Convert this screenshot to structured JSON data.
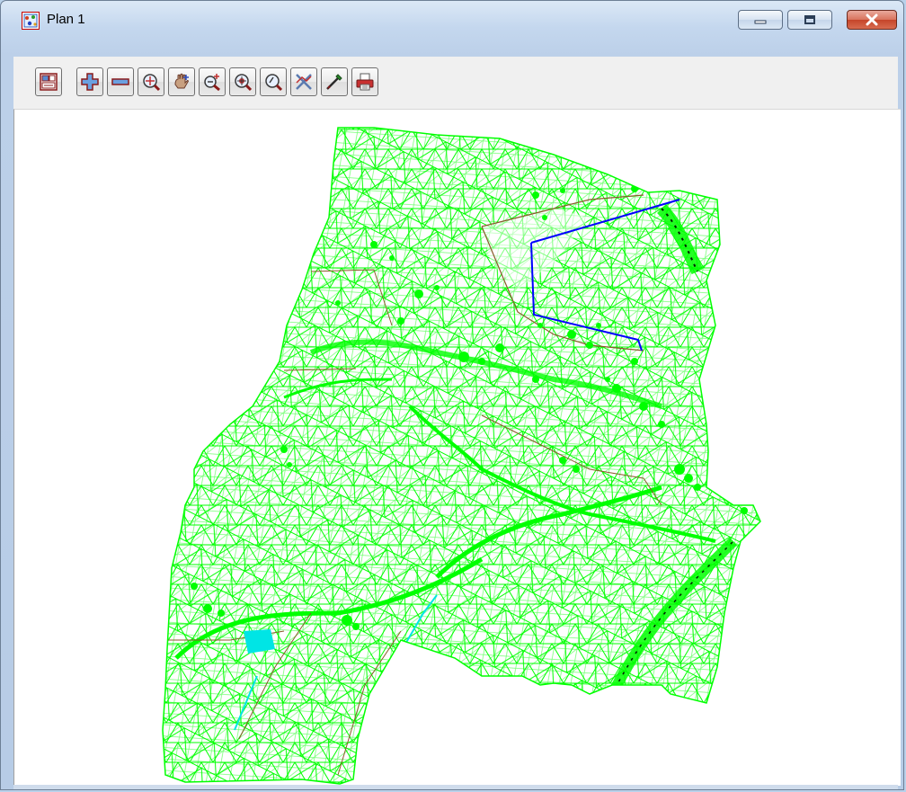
{
  "window": {
    "title": "Plan 1",
    "app_icon": "plan-view-icon",
    "caption_buttons": [
      "minimize-icon",
      "restore-icon",
      "close-icon"
    ]
  },
  "toolbar": {
    "tools": [
      {
        "name": "plot-plan-icon"
      },
      {
        "name": "zoom-in-plus-icon"
      },
      {
        "name": "zoom-out-minus-icon"
      },
      {
        "name": "zoom-extent-icon"
      },
      {
        "name": "pan-hand-icon"
      },
      {
        "name": "zoom-window-icon"
      },
      {
        "name": "zoom-centre-icon"
      },
      {
        "name": "search-icon"
      },
      {
        "name": "cross-section-icon"
      },
      {
        "name": "pick-style-icon"
      },
      {
        "name": "print-icon"
      }
    ]
  },
  "colors": {
    "mesh": "#00ff00",
    "road_line": "#0000ff",
    "water": "#00e5e5",
    "breakline": "#8b5a2b",
    "canvas_bg": "#ffffff"
  }
}
